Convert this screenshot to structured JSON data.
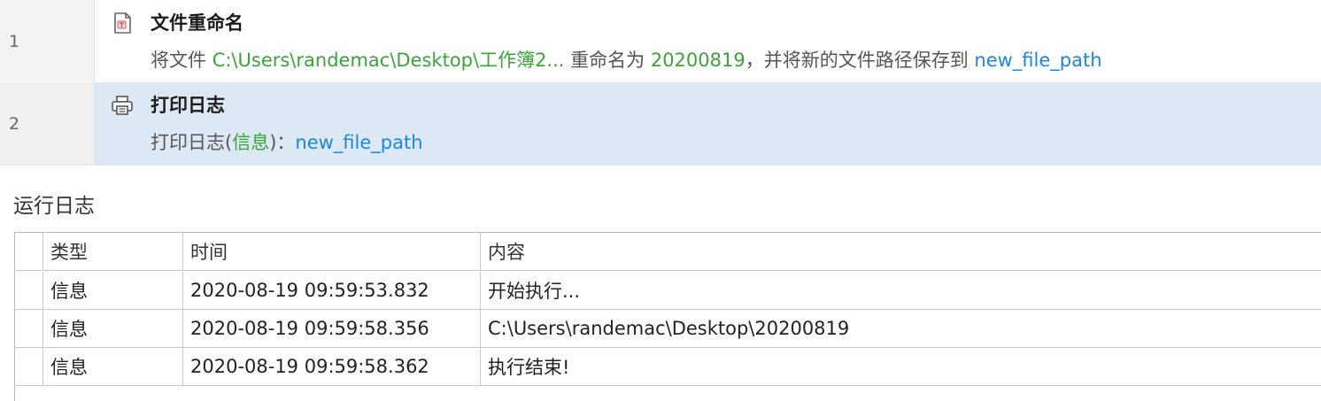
{
  "steps": [
    {
      "line": "1",
      "icon": "file-rename-icon",
      "title": "文件重命名",
      "desc": {
        "prefix": "将文件 ",
        "path": "C:\\Users\\randemac\\Desktop\\工作簿2...",
        "mid": " 重命名为 ",
        "new_name": "20200819",
        "suffix": "，并将新的文件路径保存到 ",
        "var": "new_file_path"
      }
    },
    {
      "line": "2",
      "icon": "printer-icon",
      "title": "打印日志",
      "desc": {
        "prefix": "打印日志(",
        "level": "信息",
        "mid": ")：",
        "var": "new_file_path"
      }
    }
  ],
  "log": {
    "title": "运行日志",
    "columns": [
      "类型",
      "时间",
      "内容"
    ],
    "rows": [
      {
        "type": "信息",
        "time": "2020-08-19 09:59:53.832",
        "content": "开始执行..."
      },
      {
        "type": "信息",
        "time": "2020-08-19 09:59:58.356",
        "content": "C:\\Users\\randemac\\Desktop\\20200819"
      },
      {
        "type": "信息",
        "time": "2020-08-19 09:59:58.362",
        "content": "执行结束!"
      }
    ]
  },
  "colors": {
    "selected_row": "#dde8f5",
    "green_value": "#3aa43a",
    "blue_variable": "#1b86e0"
  }
}
